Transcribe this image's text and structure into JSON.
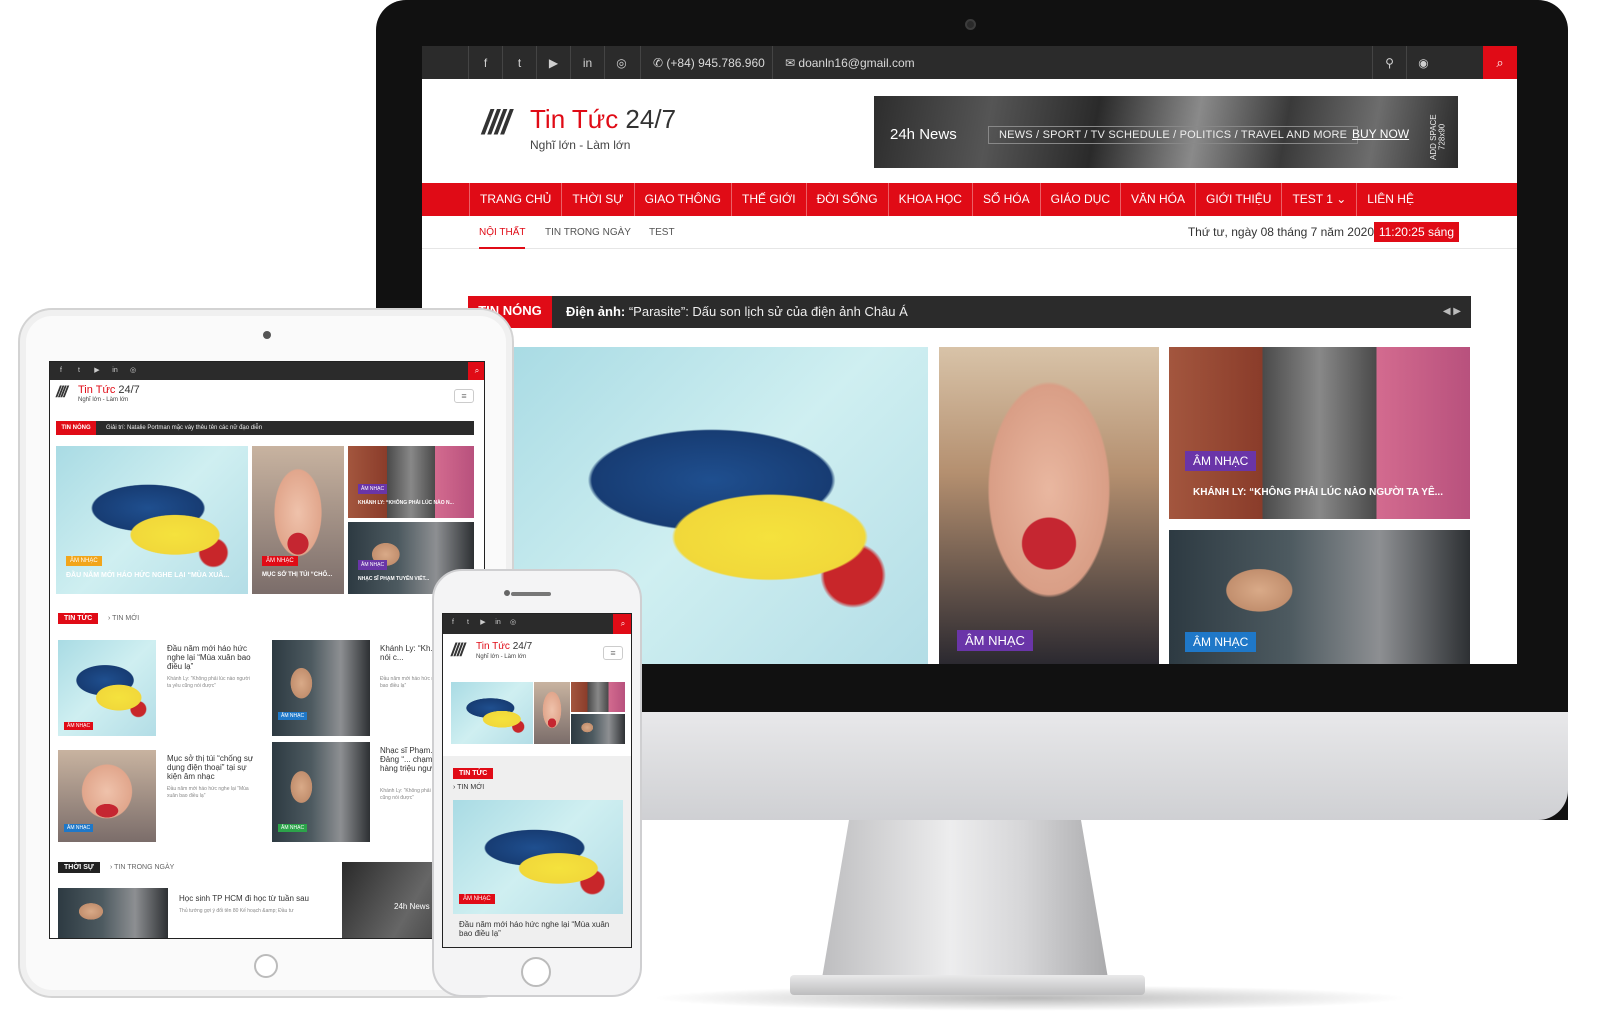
{
  "desktop": {
    "topbar": {
      "icons": [
        "facebook-icon",
        "twitter-icon",
        "youtube-icon",
        "linkedin-icon",
        "instagram-icon"
      ],
      "icon_glyphs": [
        "f",
        "t",
        "▶",
        "in",
        "◎"
      ],
      "phone": "(+84) 945.786.960",
      "email": "doanln16@gmail.com",
      "right_icons": [
        "map-marker-icon",
        "user-icon",
        "search-icon"
      ],
      "right_glyphs": [
        "⚲",
        "👤",
        "🔍"
      ]
    },
    "logo": {
      "title_red": "Tin Tức ",
      "title_dark": "24/7",
      "slogan": "Nghĩ lớn - Làm lớn",
      "mark": "////"
    },
    "ad": {
      "logo": "24h News",
      "categories": "NEWS / SPORT / TV SCHEDULE / POLITICS / TRAVEL  AND MORE",
      "buy": "BUY NOW",
      "space": "ADD SPACE 728x90"
    },
    "menu": [
      "TRANG CHỦ",
      "THỜI SỰ",
      "GIAO THÔNG",
      "THẾ GIỚI",
      "ĐỜI SỐNG",
      "KHOA HỌC",
      "SỐ HÓA",
      "GIÁO DỤC",
      "VĂN HÓA",
      "GIỚI THIỆU",
      "TEST 1  ⌄",
      "LIÊN HỆ"
    ],
    "submenu": [
      "NỘI THẤT",
      "TIN TRONG NGÀY",
      "TEST"
    ],
    "date": "Thứ tư, ngày 08 tháng 7 năm 2020",
    "clock": "11:20:25 sáng",
    "ticker": {
      "label": "TIN NÓNG",
      "category": "Điện ảnh:",
      "text": " “Parasite”: Dấu son lịch sử của điện ảnh Châu Á",
      "nav": "◀ ▶"
    },
    "tiles": {
      "madonna_badge": "ÂM NHẠC",
      "trio_badge": "ÂM NHẠC",
      "trio_caption": "KHÁNH LY: “KHÔNG PHẢI LÚC NÀO NGƯỜI TA YÊ...",
      "oldman_badge": "ÂM NHẠC"
    },
    "accent": "#e00b16",
    "purple_badge": "#6a35a8",
    "blue_badge": "#1f78c8"
  },
  "tablet": {
    "logo_red": "Tin Tức ",
    "logo_dark": "24/7",
    "slogan": "Nghĩ lớn - Làm lớn",
    "ticker_label": "TIN NÓNG",
    "ticker_text": "Giải trí: Natalie Portman mặc váy thêu tên các nữ đạo diễn",
    "hero_badge": "ÂM NHẠC",
    "hero_caption": "ĐẦU NĂM MỚI HÁO HỨC NGHE LẠI “MÙA XUÂ...",
    "madonna_badge": "ÂM NHẠC",
    "madonna_caption": "MỤC SỞ THỊ TÚI “CHỐ...",
    "trio_badge": "ÂM NHẠC",
    "trio_caption": "KHÁNH LY: “KHÔNG PHẢI LÚC NÀO N...",
    "oldman_badge": "ÂM NHẠC",
    "oldman_caption": "NHẠC SĨ PHẠM TUYÊN VIẾT...",
    "section1_label": "TIN TỨC",
    "section1_sub": "› TIN MỚI",
    "articles": [
      {
        "badge": "ÂM NHẠC",
        "title": "Đầu năm mới háo hức nghe lại “Mùa xuân bao điều lạ”",
        "desc": "Khánh Ly: “Không phải lúc nào người ta yêu cũng nói được”"
      },
      {
        "badge": "ÂM NHẠC",
        "title": "Khánh Ly: “Kh... yêu cũng nói c...",
        "desc": "Đầu năm mới háo hức nghe lại “Mùa xuân bao điều lạ”"
      },
      {
        "badge": "ÂM NHẠC",
        "title": "Mục sở thị túi “chống sự dụng điện thoại” tại sự kiện âm nhạc",
        "desc": "Đầu năm mới háo hức nghe lại “Mùa xuân bao điều lạ”"
      },
      {
        "badge": "ÂM NHẠC",
        "title": "Nhạc sĩ Phạm... viết về Đảng “... chạm vào trái... hàng triệu ngư...",
        "desc": "Khánh Ly: “Không phải lúc nào người ta yêu cũng nói được”"
      }
    ],
    "section2_label": "THỜI SỰ",
    "section2_sub": "› TIN TRONG NGÀY",
    "news_title": "Học sinh TP HCM đi học từ tuần sau",
    "news_desc": "Thủ tướng gợi ý đổi tên 80 Kế hoạch &amp; Đầu tư",
    "ad_text": "24h News"
  },
  "phone": {
    "logo_red": "Tin Tức ",
    "logo_dark": "24/7",
    "slogan": "Nghĩ lớn - Làm lớn",
    "section_label": "TIN TỨC",
    "section_sub": "› TIN MỚI",
    "hero_badge": "ÂM NHẠC",
    "hero_title": "Đầu năm mới háo hức nghe lại “Mùa xuân bao điều lạ”"
  }
}
